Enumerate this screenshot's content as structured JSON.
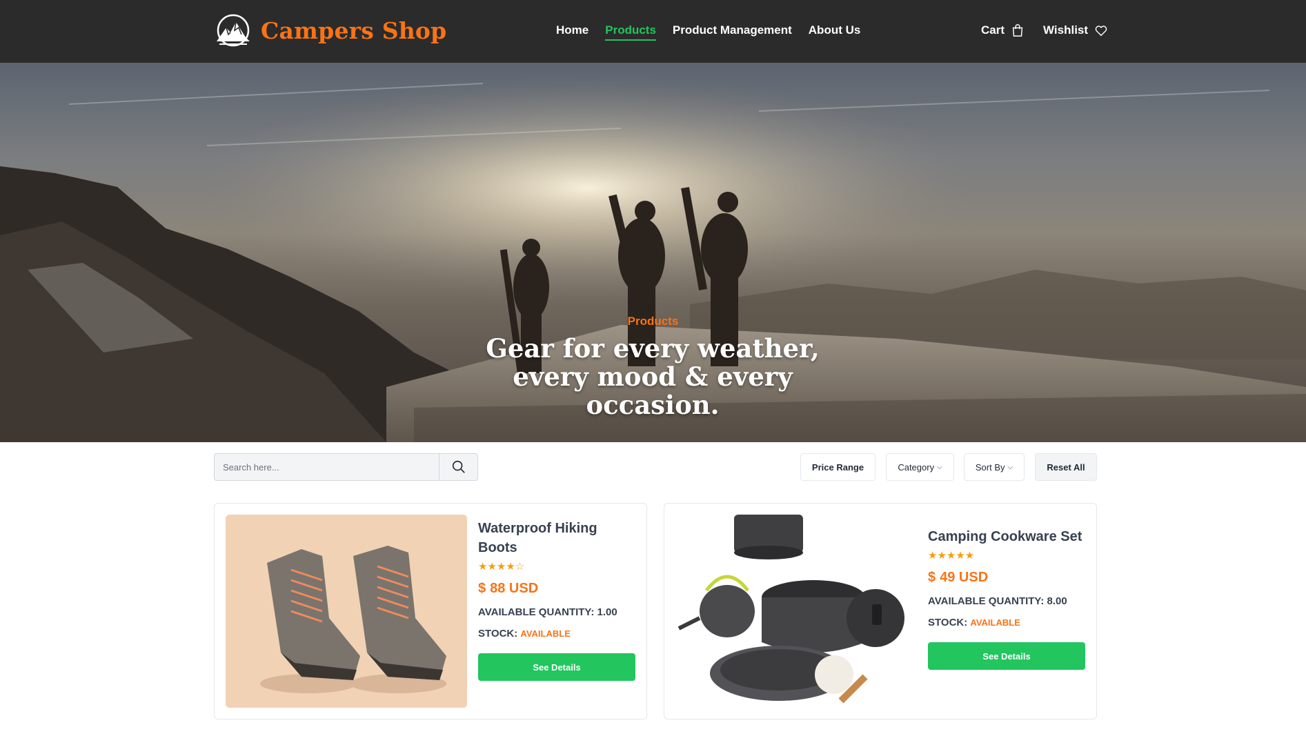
{
  "brand": {
    "name": "Campers Shop",
    "accent_color": "#f97316",
    "logo_icon": "mountain-logo-icon"
  },
  "nav": {
    "links": [
      {
        "label": "Home",
        "active": false
      },
      {
        "label": "Products",
        "active": true
      },
      {
        "label": "Product Management",
        "active": false
      },
      {
        "label": "About Us",
        "active": false
      }
    ],
    "cart_label": "Cart",
    "cart_icon": "shopping-bag-icon",
    "wishlist_label": "Wishlist",
    "wishlist_icon": "heart-icon"
  },
  "hero": {
    "eyebrow": "Products",
    "title": "Gear for every weather, every mood & every occasion."
  },
  "toolbar": {
    "search_placeholder": "Search here...",
    "search_icon": "search-icon",
    "price_range_label": "Price Range",
    "category_label": "Category",
    "sort_label": "Sort By",
    "reset_label": "Reset All"
  },
  "products": [
    {
      "name": "Waterproof Hiking Boots",
      "rating": 4,
      "rating_max": 5,
      "stars": "★★★★☆",
      "currency_symbol": "$",
      "price": "88 USD",
      "quantity_label": "AVAILABLE QUANTITY:",
      "quantity": "1.00",
      "stock_label": "STOCK:",
      "stock": "AVAILABLE",
      "button_label": "See Details"
    },
    {
      "name": "Camping Cookware Set",
      "rating": 5,
      "rating_max": 5,
      "stars": "★★★★★",
      "currency_symbol": "$",
      "price": "49 USD",
      "quantity_label": "AVAILABLE QUANTITY:",
      "quantity": "8.00",
      "stock_label": "STOCK:",
      "stock": "AVAILABLE",
      "button_label": "See Details"
    }
  ]
}
